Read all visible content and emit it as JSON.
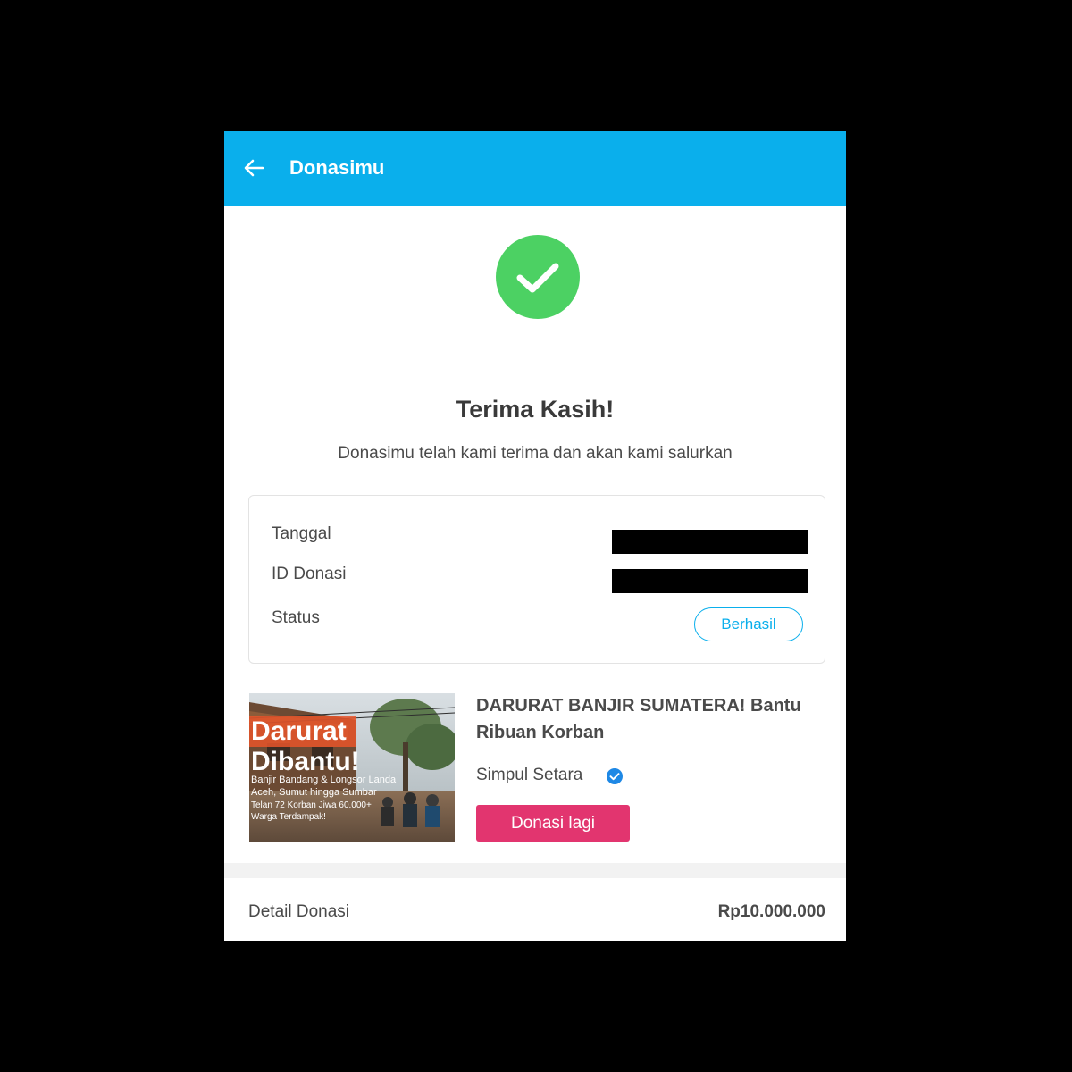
{
  "app_bar": {
    "title": "Donasimu",
    "background_color": "#0aafec",
    "back_icon": "arrow-left-icon"
  },
  "success": {
    "icon": "check-circle-icon",
    "icon_color": "#4cd163",
    "title": "Terima Kasih!",
    "subtitle": "Donasimu telah kami terima dan akan kami salurkan"
  },
  "donation_info": {
    "date_label": "Tanggal",
    "id_label": "ID Donasi",
    "status_label": "Status",
    "status_value": "Berhasil",
    "status_color": "#0aafec"
  },
  "campaign": {
    "title": "DARURAT BANJIR SUMATERA! Bantu Ribuan Korban",
    "organizer": "Simpul Setara",
    "organizer_verified_icon": "verified-check-icon",
    "donate_again_label": "Donasi lagi",
    "button_color": "#e2356f",
    "thumbnail": {
      "headline_line1": "Darurat",
      "headline_line2": "Dibantu!",
      "caption_line1": "Banjir Bandang & Longsor Landa",
      "caption_line2": "Aceh, Sumut hingga Sumbar",
      "caption_line3": "Telan 72 Korban Jiwa 60.000+",
      "caption_line4": "Warga Terdampak!"
    }
  },
  "donation_detail": {
    "label": "Detail Donasi",
    "amount": "Rp10.000.000"
  }
}
